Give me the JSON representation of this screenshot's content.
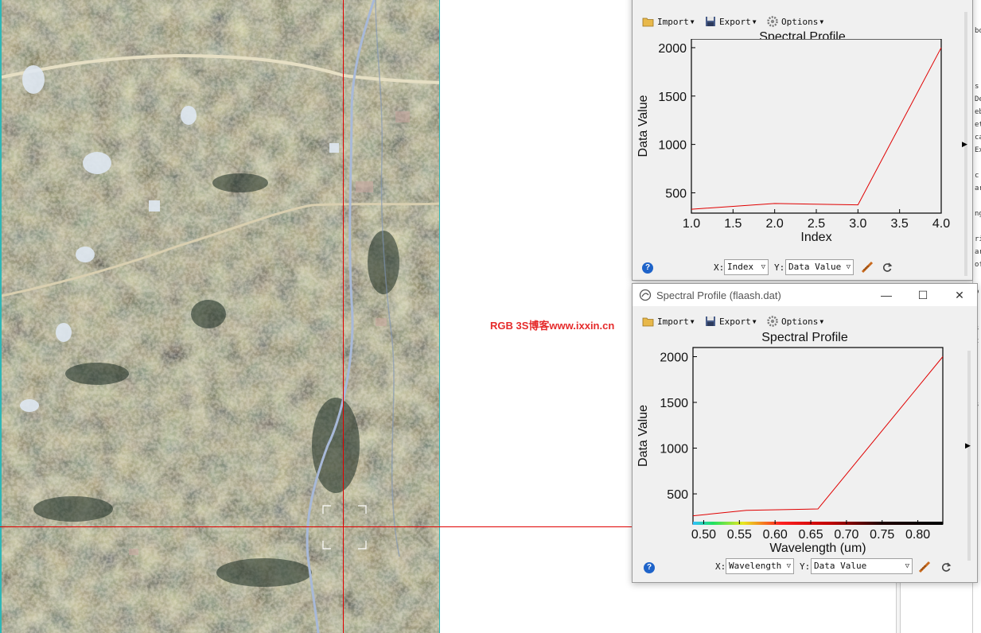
{
  "watermark": "RGB 3S博客www.ixxin.cn",
  "right_panel_fragments": [
    "bo",
    "s",
    "De",
    "eb",
    "et",
    "ca",
    "Ex",
    "c",
    "ar",
    "ng",
    "ri",
    "ar",
    "of",
    "p",
    "s",
    "t",
    "s"
  ],
  "window1": {
    "toolbar": {
      "import": "Import",
      "export": "Export",
      "options": "Options"
    },
    "plot_title": "Spectral Profile",
    "x_axis_label": "X:",
    "x_select": "Index",
    "y_axis_label": "Y:",
    "y_select": "Data Value",
    "icons": {
      "help": "?",
      "title": "envi-icon",
      "import": "folder-icon",
      "export": "save-icon",
      "options": "gear-icon",
      "style": "line-style-icon",
      "refresh": "refresh-icon"
    }
  },
  "window2": {
    "title": "Spectral Profile (flaash.dat)",
    "buttons": {
      "minimize": "—",
      "maximize": "☐",
      "close": "✕"
    },
    "toolbar": {
      "import": "Import",
      "export": "Export",
      "options": "Options"
    },
    "plot_title": "Spectral Profile",
    "x_axis_label": "X:",
    "x_select": "Wavelength",
    "y_axis_label": "Y:",
    "y_select": "Data Value",
    "icons": {
      "help": "?",
      "title": "envi-icon",
      "import": "folder-icon",
      "export": "save-icon",
      "options": "gear-icon",
      "style": "line-style-icon",
      "refresh": "refresh-icon"
    }
  },
  "colors": {
    "profile_line": "#e00000",
    "crosshair": "#e00000",
    "image_border": "#2fb7b7"
  },
  "chart_data": [
    {
      "type": "line",
      "title": "Spectral Profile",
      "xlabel": "Index",
      "ylabel": "Data Value",
      "x": [
        1.0,
        2.0,
        3.0,
        4.0
      ],
      "y": [
        330,
        390,
        375,
        2000
      ],
      "xlim": [
        1.0,
        4.0
      ],
      "ylim": [
        290,
        2090
      ],
      "xticks": [
        "1.0",
        "1.5",
        "2.0",
        "2.5",
        "3.0",
        "3.5",
        "4.0"
      ],
      "yticks": [
        "500",
        "1000",
        "1500",
        "2000"
      ],
      "color": "#e00000"
    },
    {
      "type": "line",
      "title": "Spectral Profile",
      "xlabel": "Wavelength (um)",
      "ylabel": "Data Value",
      "x": [
        0.485,
        0.56,
        0.66,
        0.835
      ],
      "y": [
        260,
        320,
        335,
        2000
      ],
      "xlim": [
        0.485,
        0.835
      ],
      "ylim": [
        170,
        2100
      ],
      "xticks": [
        "0.50",
        "0.55",
        "0.60",
        "0.65",
        "0.70",
        "0.75",
        "0.80"
      ],
      "yticks": [
        "500",
        "1000",
        "1500",
        "2000"
      ],
      "color": "#e00000",
      "wavelength_color_bar": true
    }
  ]
}
